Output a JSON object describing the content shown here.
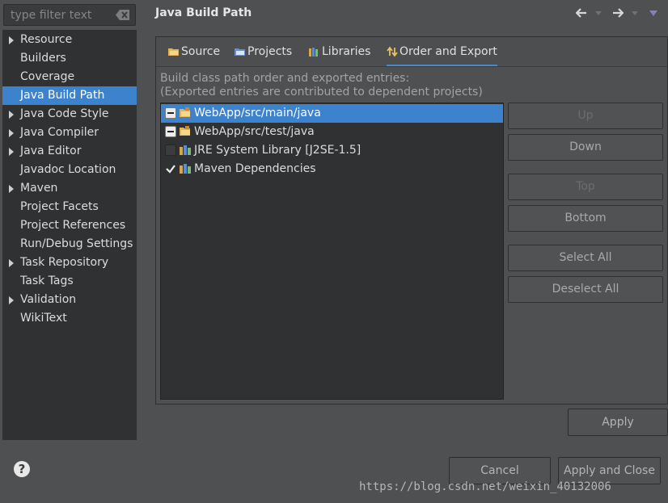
{
  "filter": {
    "placeholder": "type filter text"
  },
  "tree": {
    "items": [
      {
        "label": "Resource",
        "expandable": true
      },
      {
        "label": "Builders",
        "expandable": false
      },
      {
        "label": "Coverage",
        "expandable": false
      },
      {
        "label": "Java Build Path",
        "expandable": false,
        "selected": true
      },
      {
        "label": "Java Code Style",
        "expandable": true
      },
      {
        "label": "Java Compiler",
        "expandable": true
      },
      {
        "label": "Java Editor",
        "expandable": true
      },
      {
        "label": "Javadoc Location",
        "expandable": false
      },
      {
        "label": "Maven",
        "expandable": true
      },
      {
        "label": "Project Facets",
        "expandable": false
      },
      {
        "label": "Project References",
        "expandable": false
      },
      {
        "label": "Run/Debug Settings",
        "expandable": false
      },
      {
        "label": "Task Repository",
        "expandable": true
      },
      {
        "label": "Task Tags",
        "expandable": false
      },
      {
        "label": "Validation",
        "expandable": true
      },
      {
        "label": "WikiText",
        "expandable": false
      }
    ]
  },
  "header": {
    "title": "Java Build Path"
  },
  "tabs": [
    {
      "label": "Source",
      "icon": "source-folder-icon"
    },
    {
      "label": "Projects",
      "icon": "projects-icon"
    },
    {
      "label": "Libraries",
      "icon": "libraries-icon"
    },
    {
      "label": "Order and Export",
      "icon": "order-export-icon",
      "active": true
    }
  ],
  "order": {
    "description_line1": "Build class path order and exported entries:",
    "description_line2": "(Exported entries are contributed to dependent projects)",
    "entries": [
      {
        "label": "WebApp/src/main/java",
        "state": "partial",
        "icon": "package-folder-icon",
        "selected": true
      },
      {
        "label": "WebApp/src/test/java",
        "state": "partial",
        "icon": "package-folder-icon"
      },
      {
        "label": "JRE System Library [J2SE-1.5]",
        "state": "unchecked",
        "icon": "library-icon"
      },
      {
        "label": "Maven Dependencies",
        "state": "checked",
        "icon": "library-icon"
      }
    ],
    "buttons": {
      "up": "Up",
      "down": "Down",
      "top": "Top",
      "bottom": "Bottom",
      "select_all": "Select All",
      "deselect_all": "Deselect All"
    }
  },
  "footer": {
    "apply": "Apply",
    "cancel": "Cancel",
    "apply_close": "Apply and Close"
  },
  "watermark": "https://blog.csdn.net/weixin_40132006",
  "colors": {
    "selection": "#3d82cc",
    "background": "#4e5052",
    "list_bg": "#2f3133"
  }
}
